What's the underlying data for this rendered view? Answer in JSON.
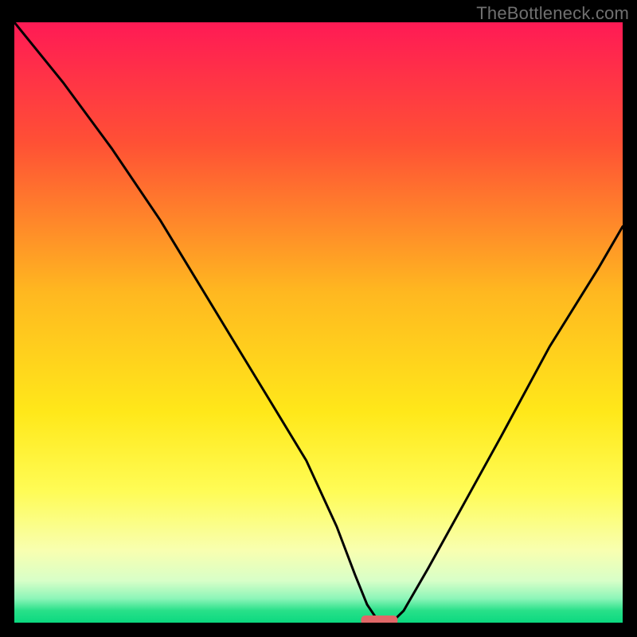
{
  "watermark": "TheBottleneck.com",
  "chart_data": {
    "type": "line",
    "title": "",
    "xlabel": "",
    "ylabel": "",
    "xlim": [
      0,
      100
    ],
    "ylim": [
      0,
      100
    ],
    "background_gradient": {
      "stops": [
        {
          "offset": 0,
          "color": "#ff1a55"
        },
        {
          "offset": 20,
          "color": "#ff5035"
        },
        {
          "offset": 45,
          "color": "#ffb820"
        },
        {
          "offset": 65,
          "color": "#ffe81a"
        },
        {
          "offset": 78,
          "color": "#fffc55"
        },
        {
          "offset": 88,
          "color": "#f8ffb0"
        },
        {
          "offset": 93,
          "color": "#d8ffc8"
        },
        {
          "offset": 96,
          "color": "#8cf5b8"
        },
        {
          "offset": 98,
          "color": "#28e089"
        },
        {
          "offset": 100,
          "color": "#0bd980"
        }
      ]
    },
    "series": [
      {
        "name": "bottleneck-curve",
        "color": "#000000",
        "x": [
          0,
          8,
          16,
          24,
          30,
          36,
          42,
          48,
          53,
          56,
          58,
          60,
          62,
          64,
          68,
          74,
          80,
          88,
          96,
          100
        ],
        "values": [
          100,
          90,
          79,
          67,
          57,
          47,
          37,
          27,
          16,
          8,
          3,
          0,
          0,
          2,
          9,
          20,
          31,
          46,
          59,
          66
        ]
      }
    ],
    "marker": {
      "name": "optimum-marker",
      "x": 60,
      "y": 0,
      "width": 6,
      "height": 1.6,
      "color": "#e06868"
    }
  }
}
